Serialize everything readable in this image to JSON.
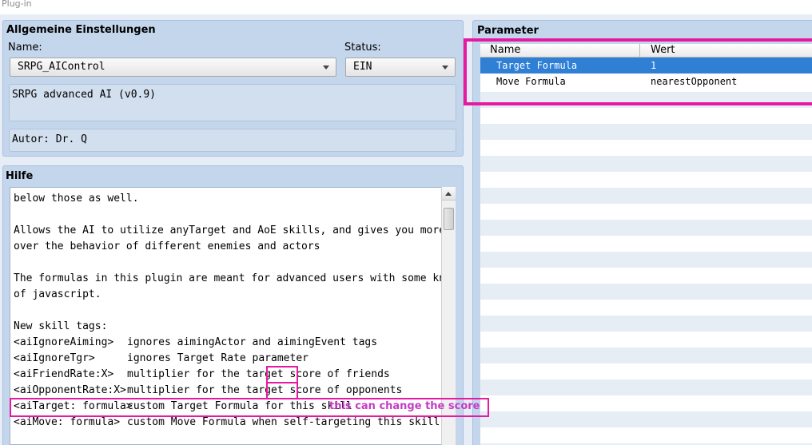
{
  "window": {
    "title": "Plug-in"
  },
  "general": {
    "title": "Allgemeine Einstellungen",
    "name_label": "Name:",
    "name_value": "SRPG_AIControl",
    "status_label": "Status:",
    "status_value": "EIN",
    "description": "SRPG advanced AI (v0.9)",
    "author": "Autor: Dr. Q"
  },
  "help": {
    "title": "Hilfe",
    "lines": [
      "below those as well.",
      "",
      "Allows the AI to utilize anyTarget and AoE skills, and gives you more control",
      "over the behavior of different enemies and actors",
      "",
      "The formulas in this plugin are meant for advanced users with some knowledge",
      "of javascript.",
      "",
      "New skill tags:"
    ],
    "tags": [
      {
        "tag": "<aiIgnoreAiming>",
        "desc": "ignores aimingActor and aimingEvent tags"
      },
      {
        "tag": "<aiIgnoreTgr>",
        "desc": "ignores Target Rate parameter"
      },
      {
        "tag": "<aiFriendRate:X>",
        "desc": "multiplier for the target score of friends"
      },
      {
        "tag": "<aiOpponentRate:X>",
        "desc": "multiplier for the target score of opponents"
      },
      {
        "tag": "<aiTarget: formula>",
        "desc": "custom Target Formula for this skill"
      },
      {
        "tag": "<aiMove: formula>",
        "desc": "custom Move Formula when self-targeting this skill"
      }
    ]
  },
  "parameters": {
    "title": "Parameter",
    "columns": [
      "Name",
      "Wert"
    ],
    "rows": [
      {
        "name": "Target Formula",
        "value": "1",
        "selected": true
      },
      {
        "name": "Move Formula",
        "value": "nearestOpponent",
        "selected": false
      }
    ]
  },
  "annotations": {
    "score_note": "this can change the score",
    "highlight_color": "#e61aa0",
    "note_color": "#c43cc4"
  },
  "colors": {
    "panel": "#c4d6ec",
    "selection": "#2f7fd4"
  }
}
